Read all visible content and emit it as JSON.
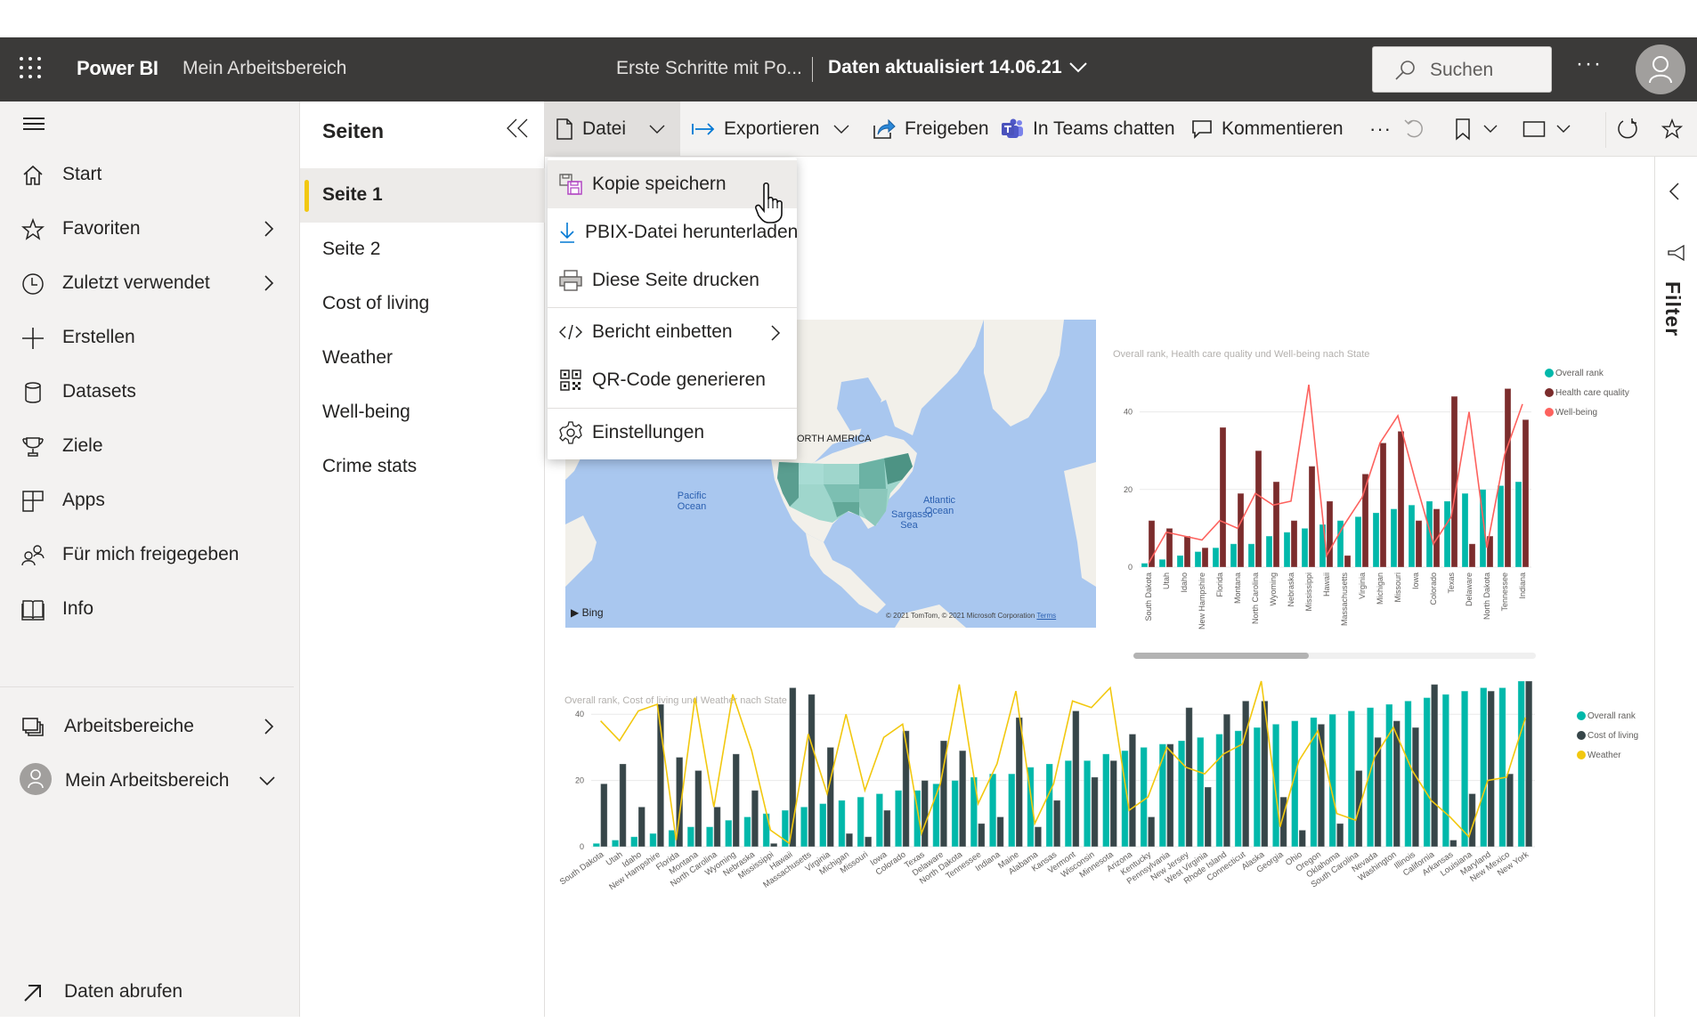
{
  "topbar": {
    "brand": "Power BI",
    "workspace": "Mein Arbeitsbereich",
    "report_title": "Erste Schritte mit Po...",
    "refresh_info": "Daten aktualisiert 14.06.21",
    "search_placeholder": "Suchen",
    "more": "···"
  },
  "sidebar": {
    "items": [
      {
        "label": "Start",
        "icon": "home-icon"
      },
      {
        "label": "Favoriten",
        "icon": "star-icon",
        "chevron": true
      },
      {
        "label": "Zuletzt verwendet",
        "icon": "clock-icon",
        "chevron": true
      },
      {
        "label": "Erstellen",
        "icon": "plus-icon"
      },
      {
        "label": "Datasets",
        "icon": "database-icon"
      },
      {
        "label": "Ziele",
        "icon": "trophy-icon"
      },
      {
        "label": "Apps",
        "icon": "apps-icon"
      },
      {
        "label": "Für mich freigegeben",
        "icon": "shared-people-icon"
      },
      {
        "label": "Info",
        "icon": "book-icon"
      }
    ],
    "workspaces": "Arbeitsbereiche",
    "my_workspace": "Mein Arbeitsbereich",
    "get_data": "Daten abrufen"
  },
  "pages": {
    "title": "Seiten",
    "items": [
      "Seite 1",
      "Seite 2",
      "Cost of living",
      "Weather",
      "Well-being",
      "Crime stats"
    ],
    "active": "Seite 1"
  },
  "toolbar": {
    "file": "Datei",
    "export": "Exportieren",
    "share": "Freigeben",
    "teams": "In Teams chatten",
    "comment": "Kommentieren",
    "more": "···"
  },
  "file_menu": {
    "items": [
      {
        "label": "Kopie speichern",
        "icon": "save-copy-icon"
      },
      {
        "label": "PBIX-Datei herunterladen",
        "icon": "download-icon"
      },
      {
        "label": "Diese Seite drucken",
        "icon": "print-icon"
      },
      {
        "label": "Bericht einbetten",
        "icon": "embed-code-icon",
        "submenu": true
      },
      {
        "label": "QR-Code generieren",
        "icon": "qr-code-icon"
      },
      {
        "label": "Einstellungen",
        "icon": "settings-gear-icon"
      }
    ],
    "hovered": "Kopie speichern"
  },
  "filter_pane": {
    "label": "Filter"
  },
  "map": {
    "labels": {
      "continent": "NORTH AMERICA",
      "pacific": "Pacific Ocean",
      "atlantic": "Atlantic Ocean",
      "sargasso": "Sargasso Sea"
    },
    "provider": "Bing",
    "copyright": "© 2021 TomTom, © 2021 Microsoft Corporation",
    "terms": "Terms"
  },
  "colors": {
    "overall_rank": "#01b8aa",
    "health_care": "#7b2c2c",
    "well_being": "#fd625e",
    "cost_of_living": "#374649",
    "weather": "#f2c80f",
    "accent": "#f2c811",
    "topbar": "#3b3a39"
  },
  "chart_data": [
    {
      "type": "bar",
      "title": "Overall rank, Health care quality und Well-being nach State",
      "xlabel": "",
      "ylabel": "",
      "ylim": [
        0,
        50
      ],
      "yticks": [
        0,
        20,
        40
      ],
      "grid": true,
      "legend": "top-right",
      "categories": [
        "South Dakota",
        "Utah",
        "Idaho",
        "New Hampshire",
        "Florida",
        "Montana",
        "North Carolina",
        "Wyoming",
        "Nebraska",
        "Mississippi",
        "Hawaii",
        "Massachusetts",
        "Virginia",
        "Michigan",
        "Missouri",
        "Iowa",
        "Colorado",
        "Texas",
        "Delaware",
        "North Dakota",
        "Tennessee",
        "Indiana"
      ],
      "series": [
        {
          "name": "Overall rank",
          "kind": "bar",
          "values": [
            1,
            2,
            3,
            4,
            5,
            6,
            6,
            8,
            9,
            10,
            11,
            12,
            13,
            14,
            15,
            16,
            17,
            17,
            19,
            20,
            21,
            22
          ]
        },
        {
          "name": "Health care quality",
          "kind": "bar",
          "values": [
            12,
            10,
            8,
            5,
            36,
            19,
            30,
            22,
            12,
            26,
            17,
            3,
            24,
            32,
            35,
            12,
            15,
            44,
            6,
            8,
            46,
            38
          ]
        },
        {
          "name": "Well-being",
          "kind": "line",
          "values": [
            1,
            9,
            8,
            7,
            12,
            10,
            19,
            16,
            17,
            47,
            3,
            11,
            18,
            32,
            39,
            22,
            6,
            13,
            40,
            5,
            29,
            42
          ]
        }
      ],
      "scrollbar": "horizontal"
    },
    {
      "type": "bar",
      "title": "Overall rank, Cost of living und Weather nach State",
      "xlabel": "",
      "ylabel": "",
      "ylim": [
        0,
        50
      ],
      "yticks": [
        0,
        20,
        40
      ],
      "grid": true,
      "legend": "top-right",
      "categories": [
        "South Dakota",
        "Utah",
        "Idaho",
        "New Hampshire",
        "Florida",
        "Montana",
        "North Carolina",
        "Wyoming",
        "Nebraska",
        "Mississippi",
        "Hawaii",
        "Massachusetts",
        "Virginia",
        "Michigan",
        "Missouri",
        "Iowa",
        "Colorado",
        "Texas",
        "Delaware",
        "North Dakota",
        "Tennessee",
        "Indiana",
        "Maine",
        "Alabama",
        "Kansas",
        "Vermont",
        "Wisconsin",
        "Minnesota",
        "Arizona",
        "Kentucky",
        "Pennsylvania",
        "New Jersey",
        "West Virginia",
        "Rhode Island",
        "Connecticut",
        "Alaska",
        "Georgia",
        "Ohio",
        "Oregon",
        "Oklahoma",
        "South Carolina",
        "Nevada",
        "Washington",
        "Illinois",
        "California",
        "Arkansas",
        "Louisiana",
        "Maryland",
        "New Mexico",
        "New York"
      ],
      "series": [
        {
          "name": "Overall rank",
          "kind": "bar",
          "values": [
            1,
            2,
            3,
            4,
            5,
            6,
            6,
            8,
            9,
            10,
            11,
            12,
            13,
            14,
            15,
            16,
            17,
            17,
            19,
            20,
            21,
            22,
            22,
            24,
            25,
            26,
            26,
            28,
            29,
            30,
            31,
            32,
            33,
            34,
            35,
            36,
            37,
            38,
            39,
            40,
            41,
            42,
            43,
            44,
            45,
            46,
            47,
            48,
            48,
            50
          ]
        },
        {
          "name": "Cost of living",
          "kind": "bar",
          "values": [
            19,
            25,
            12,
            43,
            27,
            23,
            12,
            28,
            17,
            1,
            48,
            46,
            30,
            4,
            3,
            11,
            35,
            20,
            32,
            29,
            7,
            9,
            39,
            6,
            14,
            41,
            21,
            26,
            34,
            9,
            31,
            42,
            18,
            40,
            44,
            44,
            15,
            5,
            37,
            7,
            23,
            33,
            38,
            36,
            49,
            2,
            16,
            47,
            22,
            50
          ]
        },
        {
          "name": "Weather",
          "kind": "line",
          "values": [
            38,
            32,
            41,
            43,
            2,
            45,
            12,
            46,
            29,
            5,
            1,
            34,
            16,
            40,
            17,
            33,
            37,
            4,
            19,
            49,
            13,
            25,
            47,
            7,
            19,
            44,
            42,
            48,
            11,
            15,
            30,
            24,
            22,
            28,
            31,
            50,
            6,
            26,
            35,
            10,
            8,
            27,
            36,
            23,
            14,
            9,
            3,
            20,
            21,
            39
          ]
        }
      ]
    }
  ]
}
